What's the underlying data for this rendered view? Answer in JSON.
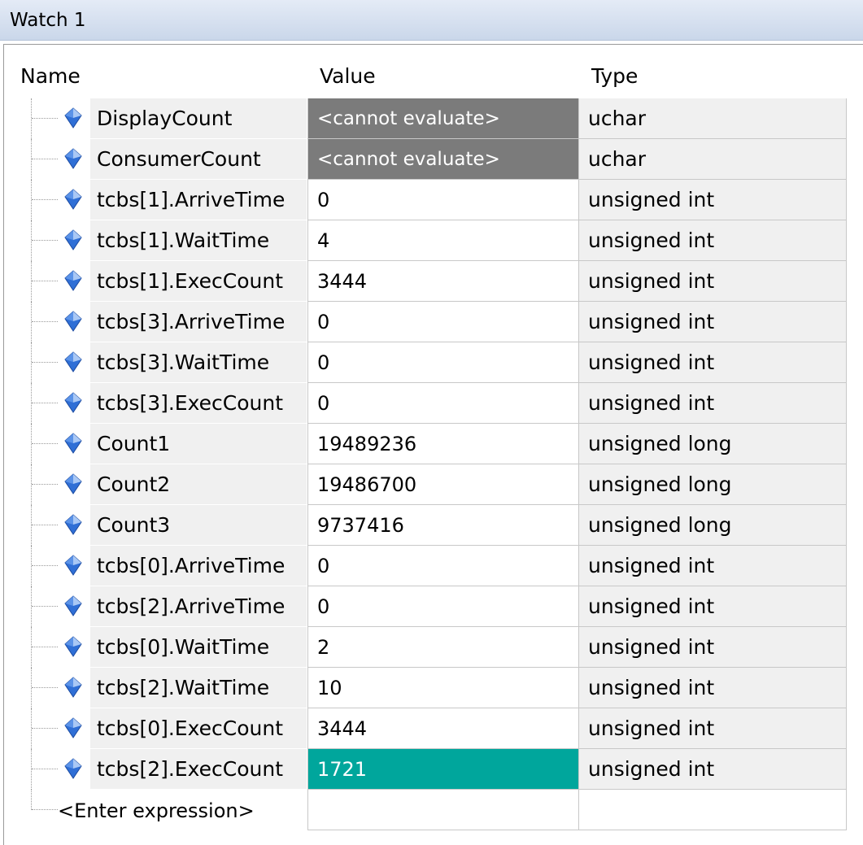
{
  "window": {
    "title": "Watch 1"
  },
  "columns": {
    "name": "Name",
    "value": "Value",
    "type": "Type"
  },
  "icon": "watch-variable-icon",
  "colors": {
    "cannot_evaluate_bg": "#7b7b7b",
    "changed_value_bg": "#00a69c"
  },
  "rows": [
    {
      "name": "DisplayCount",
      "value": "<cannot evaluate>",
      "type": "uchar",
      "state": "cannot"
    },
    {
      "name": "ConsumerCount",
      "value": "<cannot evaluate>",
      "type": "uchar",
      "state": "cannot"
    },
    {
      "name": "tcbs[1].ArriveTime",
      "value": "0",
      "type": "unsigned int",
      "state": "normal"
    },
    {
      "name": "tcbs[1].WaitTime",
      "value": "4",
      "type": "unsigned int",
      "state": "normal"
    },
    {
      "name": "tcbs[1].ExecCount",
      "value": "3444",
      "type": "unsigned int",
      "state": "normal"
    },
    {
      "name": "tcbs[3].ArriveTime",
      "value": "0",
      "type": "unsigned int",
      "state": "normal"
    },
    {
      "name": "tcbs[3].WaitTime",
      "value": "0",
      "type": "unsigned int",
      "state": "normal"
    },
    {
      "name": "tcbs[3].ExecCount",
      "value": "0",
      "type": "unsigned int",
      "state": "normal"
    },
    {
      "name": "Count1",
      "value": "19489236",
      "type": "unsigned long",
      "state": "normal"
    },
    {
      "name": "Count2",
      "value": "19486700",
      "type": "unsigned long",
      "state": "normal"
    },
    {
      "name": "Count3",
      "value": "9737416",
      "type": "unsigned long",
      "state": "normal"
    },
    {
      "name": "tcbs[0].ArriveTime",
      "value": "0",
      "type": "unsigned int",
      "state": "normal"
    },
    {
      "name": "tcbs[2].ArriveTime",
      "value": "0",
      "type": "unsigned int",
      "state": "normal"
    },
    {
      "name": "tcbs[0].WaitTime",
      "value": "2",
      "type": "unsigned int",
      "state": "normal"
    },
    {
      "name": "tcbs[2].WaitTime",
      "value": "10",
      "type": "unsigned int",
      "state": "normal"
    },
    {
      "name": "tcbs[0].ExecCount",
      "value": "3444",
      "type": "unsigned int",
      "state": "normal"
    },
    {
      "name": "tcbs[2].ExecCount",
      "value": "1721",
      "type": "unsigned int",
      "state": "changed"
    }
  ],
  "enter_expression": {
    "label": "<Enter expression>"
  }
}
